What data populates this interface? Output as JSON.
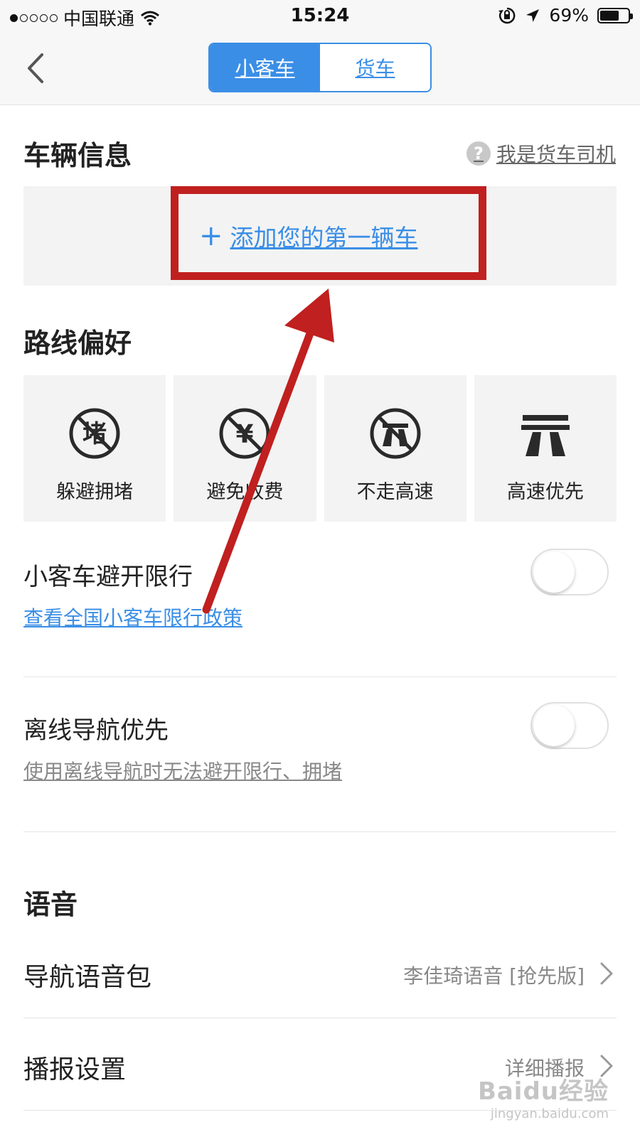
{
  "status_bar": {
    "carrier": "中国联通",
    "time": "15:24",
    "battery": "69%",
    "battery_level": 0.69,
    "signal_bars_filled": 1,
    "signal_bars_total": 5
  },
  "header": {
    "tabs": [
      {
        "label": "小客车",
        "active": true
      },
      {
        "label": "货车",
        "active": false
      }
    ]
  },
  "vehicle": {
    "title": "车辆信息",
    "driver_link": "我是货车司机",
    "help_glyph": "?",
    "add_plus": "+",
    "add_label": "添加您的第一辆车"
  },
  "route": {
    "title": "路线偏好",
    "options": [
      {
        "label": "躲避拥堵",
        "icon": "avoid-congestion-icon"
      },
      {
        "label": "避免收费",
        "icon": "avoid-toll-icon"
      },
      {
        "label": "不走高速",
        "icon": "no-highway-icon"
      },
      {
        "label": "高速优先",
        "icon": "highway-first-icon"
      }
    ]
  },
  "restriction": {
    "title": "小客车避开限行",
    "link": "查看全国小客车限行政策",
    "enabled": false
  },
  "offline": {
    "title": "离线导航优先",
    "note": "使用离线导航时无法避开限行、拥堵",
    "enabled": false
  },
  "voice": {
    "title": "语音",
    "items": [
      {
        "label": "导航语音包",
        "value": "李佳琦语音 [抢先版]"
      },
      {
        "label": "播报设置",
        "value": "详细播报"
      }
    ]
  },
  "watermark": {
    "main": "Baidu经验",
    "sub": "jingyan.baidu.com"
  },
  "colors": {
    "accent": "#3a8ee6",
    "annotation": "#c0201f"
  }
}
